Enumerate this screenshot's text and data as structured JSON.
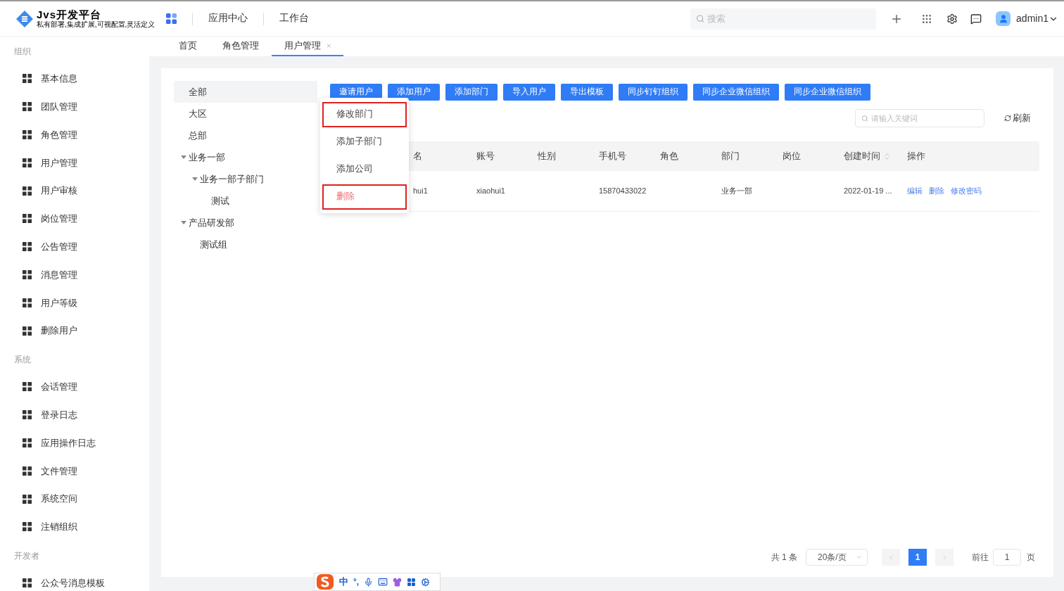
{
  "header": {
    "logo_title": "Jvs开发平台",
    "logo_subtitle": "私有部署,集成扩展,可视配置,灵活定义",
    "nav": [
      {
        "label": "应用中心"
      },
      {
        "label": "工作台"
      }
    ],
    "search": {
      "placeholder": "搜索"
    },
    "user": "admin1"
  },
  "tabs": [
    {
      "label": "首页",
      "selected": false,
      "closable": false
    },
    {
      "label": "角色管理",
      "selected": false,
      "closable": false
    },
    {
      "label": "用户管理",
      "selected": true,
      "closable": true,
      "close": "×"
    }
  ],
  "sidebar": [
    {
      "group": "组织",
      "items": [
        "基本信息",
        "团队管理",
        "角色管理",
        "用户管理",
        "用户审核",
        "岗位管理",
        "公告管理",
        "消息管理",
        "用户等级",
        "删除用户"
      ]
    },
    {
      "group": "系统",
      "items": [
        "会话管理",
        "登录日志",
        "应用操作日志",
        "文件管理",
        "系统空间",
        "注销组织"
      ]
    },
    {
      "group": "开发者",
      "items": [
        "公众号消息模板"
      ]
    }
  ],
  "tree": [
    {
      "label": "全部",
      "selected": true
    },
    {
      "label": "大区",
      "selected": false
    },
    {
      "label": "总部",
      "selected": false
    },
    {
      "label": "业务一部",
      "selected": false,
      "expanded": true,
      "children": [
        {
          "label": "业务一部子部门",
          "selected": false,
          "expanded": true,
          "children": [
            {
              "label": "测试",
              "selected": false
            }
          ]
        }
      ]
    },
    {
      "label": "产品研发部",
      "selected": false,
      "expanded": true,
      "children": [
        {
          "label": "测试组",
          "selected": false
        }
      ]
    }
  ],
  "toolbar": [
    "邀请用户",
    "添加用户",
    "添加部门",
    "导入用户",
    "导出模板",
    "同步钉钉组织",
    "同步企业微信组织",
    "同步企业微信组织"
  ],
  "context_menu": [
    {
      "label": "修改部门",
      "kind": "normal",
      "highlighted": true
    },
    {
      "label": "添加子部门",
      "kind": "normal",
      "highlighted": false
    },
    {
      "label": "添加公司",
      "kind": "normal",
      "highlighted": false
    },
    {
      "label": "删除",
      "kind": "danger",
      "highlighted": true
    }
  ],
  "keyword_search": {
    "placeholder": "请输入关键词"
  },
  "refresh": "刷新",
  "table": {
    "columns": [
      {
        "label": "名",
        "sortable": false
      },
      {
        "label": "账号",
        "sortable": false
      },
      {
        "label": "性别",
        "sortable": false
      },
      {
        "label": "手机号",
        "sortable": false
      },
      {
        "label": "角色",
        "sortable": false
      },
      {
        "label": "部门",
        "sortable": false
      },
      {
        "label": "岗位",
        "sortable": false
      },
      {
        "label": "创建时间",
        "sortable": true
      },
      {
        "label": "操作",
        "sortable": false
      }
    ],
    "rows": [
      {
        "cells": [
          "hui1",
          "xiaohui1",
          "",
          "15870433022",
          "",
          "业务一部",
          "",
          "2022-01-19 ..."
        ],
        "actions": [
          "编辑",
          "删除",
          "修改密码"
        ]
      }
    ]
  },
  "pagination": {
    "total": "共 1 条",
    "page_size": "20条/页",
    "pages": [
      {
        "label": "1",
        "selected": true
      }
    ],
    "prev_disabled": true,
    "next_disabled": true,
    "goto": "前往",
    "goto_value": "1",
    "page_unit": "页"
  },
  "ime_bar": {
    "mode": "中",
    "punct": "°,"
  }
}
